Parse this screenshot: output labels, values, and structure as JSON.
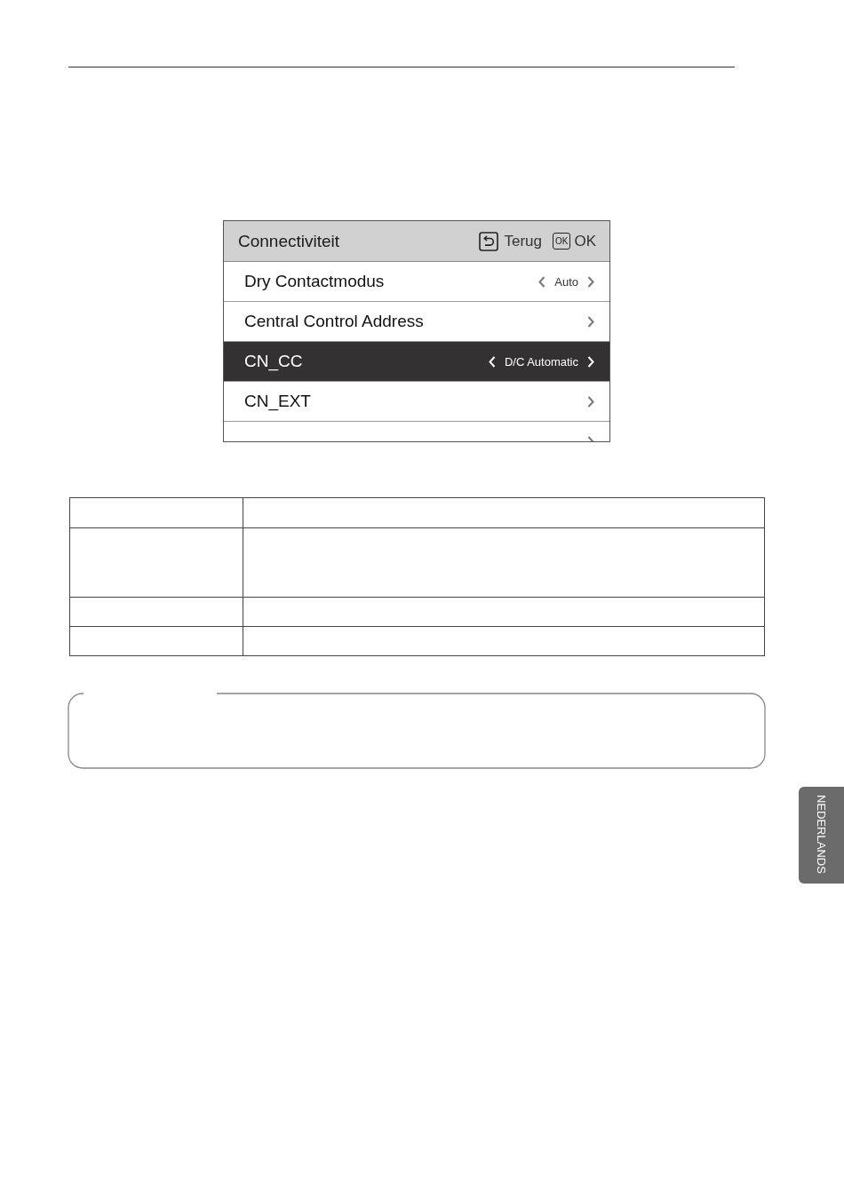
{
  "screen": {
    "title": "Connectiviteit",
    "back_label": "Terug",
    "ok_key": "OK",
    "ok_label": "OK",
    "items": [
      {
        "label": "Dry Contactmodus",
        "kind": "selector",
        "value": "Auto",
        "selected": false
      },
      {
        "label": "Central Control Address",
        "kind": "submenu",
        "selected": false
      },
      {
        "label": "CN_CC",
        "kind": "selector",
        "value": "D/C Automatic",
        "selected": true
      },
      {
        "label": "CN_EXT",
        "kind": "submenu",
        "selected": false
      },
      {
        "kind": "submenu",
        "selected": false
      }
    ]
  },
  "side_tab": {
    "label": "NEDERLANDS"
  }
}
